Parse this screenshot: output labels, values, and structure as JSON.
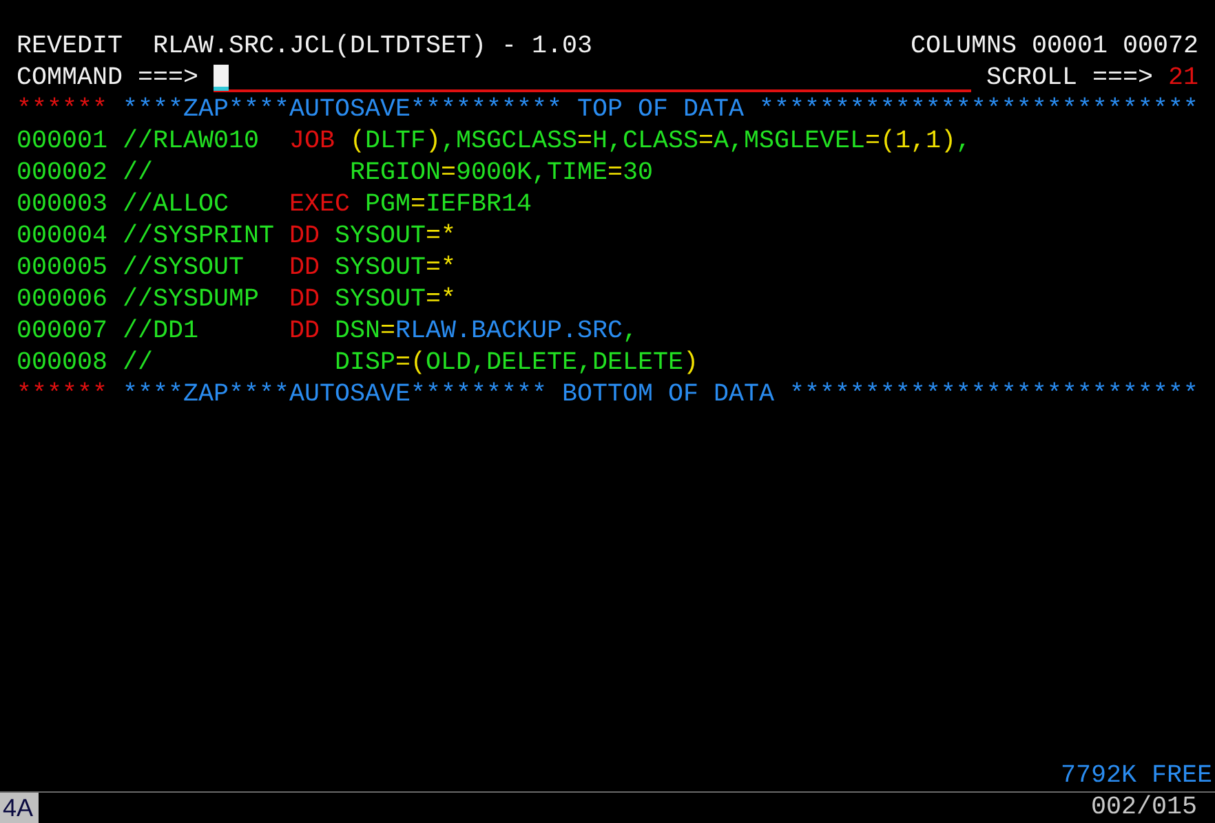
{
  "header": {
    "title": "REVEDIT  RLAW.SRC.JCL(DLTDTSET) - 1.03",
    "columns": "COLUMNS 00001 00072"
  },
  "command": {
    "label": "COMMAND ===>",
    "scroll_label": "SCROLL ===>",
    "scroll_value": "21"
  },
  "lines": [
    {
      "number": {
        "text": "******",
        "color": "#e01010"
      },
      "segments": [
        {
          "text": "****ZAP****AUTOSAVE********** TOP OF DATA *****************************",
          "color": "#2a8cf0"
        }
      ]
    },
    {
      "number": {
        "text": "000001",
        "color": "#22e022"
      },
      "segments": [
        {
          "text": "//RLAW010  ",
          "color": "#22e022"
        },
        {
          "text": "JOB",
          "color": "#e01010"
        },
        {
          "text": " (",
          "color": "#f0e000"
        },
        {
          "text": "DLTF",
          "color": "#22e022"
        },
        {
          "text": ")",
          "color": "#f0e000"
        },
        {
          "text": ",MSGCLASS",
          "color": "#22e022"
        },
        {
          "text": "=",
          "color": "#f0e000"
        },
        {
          "text": "H,CLASS",
          "color": "#22e022"
        },
        {
          "text": "=",
          "color": "#f0e000"
        },
        {
          "text": "A,MSGLEVEL",
          "color": "#22e022"
        },
        {
          "text": "=(1,1)",
          "color": "#f0e000"
        },
        {
          "text": ",",
          "color": "#22e022"
        }
      ]
    },
    {
      "number": {
        "text": "000002",
        "color": "#22e022"
      },
      "segments": [
        {
          "text": "//             REGION",
          "color": "#22e022"
        },
        {
          "text": "=",
          "color": "#f0e000"
        },
        {
          "text": "9000K,TIME",
          "color": "#22e022"
        },
        {
          "text": "=",
          "color": "#f0e000"
        },
        {
          "text": "30",
          "color": "#22e022"
        }
      ]
    },
    {
      "number": {
        "text": "000003",
        "color": "#22e022"
      },
      "segments": [
        {
          "text": "//ALLOC    ",
          "color": "#22e022"
        },
        {
          "text": "EXEC",
          "color": "#e01010"
        },
        {
          "text": " PGM",
          "color": "#22e022"
        },
        {
          "text": "=",
          "color": "#f0e000"
        },
        {
          "text": "IEFBR14",
          "color": "#22e022"
        }
      ]
    },
    {
      "number": {
        "text": "000004",
        "color": "#22e022"
      },
      "segments": [
        {
          "text": "//SYSPRINT ",
          "color": "#22e022"
        },
        {
          "text": "DD",
          "color": "#e01010"
        },
        {
          "text": " SYSOUT",
          "color": "#22e022"
        },
        {
          "text": "=*",
          "color": "#f0e000"
        }
      ]
    },
    {
      "number": {
        "text": "000005",
        "color": "#22e022"
      },
      "segments": [
        {
          "text": "//SYSOUT   ",
          "color": "#22e022"
        },
        {
          "text": "DD",
          "color": "#e01010"
        },
        {
          "text": " SYSOUT",
          "color": "#22e022"
        },
        {
          "text": "=*",
          "color": "#f0e000"
        }
      ]
    },
    {
      "number": {
        "text": "000006",
        "color": "#22e022"
      },
      "segments": [
        {
          "text": "//SYSDUMP  ",
          "color": "#22e022"
        },
        {
          "text": "DD",
          "color": "#e01010"
        },
        {
          "text": " SYSOUT",
          "color": "#22e022"
        },
        {
          "text": "=*",
          "color": "#f0e000"
        }
      ]
    },
    {
      "number": {
        "text": "000007",
        "color": "#22e022"
      },
      "segments": [
        {
          "text": "//DD1      ",
          "color": "#22e022"
        },
        {
          "text": "DD",
          "color": "#e01010"
        },
        {
          "text": " DSN",
          "color": "#22e022"
        },
        {
          "text": "=",
          "color": "#f0e000"
        },
        {
          "text": "RLAW.BACKUP.SRC",
          "color": "#2a8cf0"
        },
        {
          "text": ",",
          "color": "#22e022"
        }
      ]
    },
    {
      "number": {
        "text": "000008",
        "color": "#22e022"
      },
      "segments": [
        {
          "text": "//            DISP",
          "color": "#22e022"
        },
        {
          "text": "=(",
          "color": "#f0e000"
        },
        {
          "text": "OLD,DELETE,DELETE",
          "color": "#22e022"
        },
        {
          "text": ")",
          "color": "#f0e000"
        }
      ]
    },
    {
      "number": {
        "text": "******",
        "color": "#e01010"
      },
      "segments": [
        {
          "text": "****ZAP****AUTOSAVE********* BOTTOM OF DATA ***************************",
          "color": "#2a8cf0"
        }
      ]
    }
  ],
  "status": {
    "free": "7792K FREE",
    "indicator": "4A",
    "position": "002/015"
  }
}
